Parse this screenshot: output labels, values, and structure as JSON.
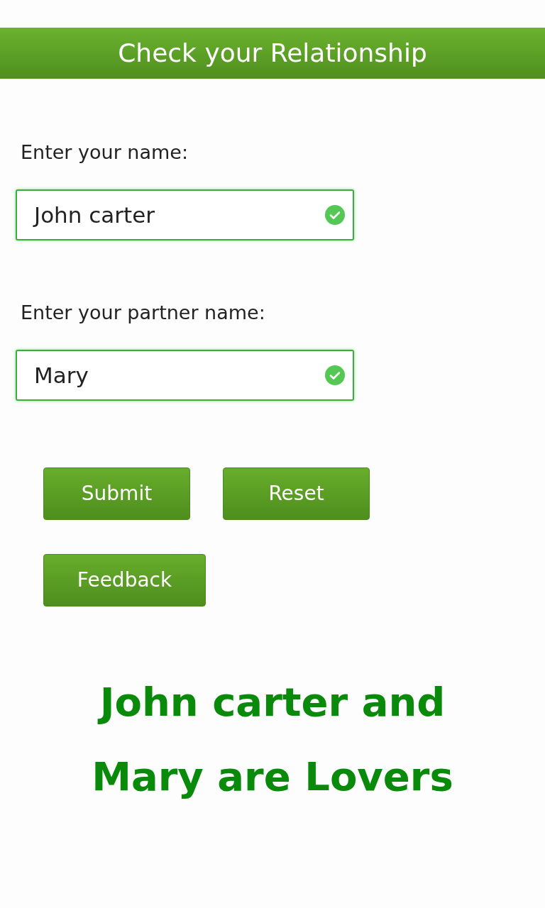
{
  "header": {
    "title": "Check your Relationship"
  },
  "fields": [
    {
      "label": "Enter your name:",
      "value": "John carter",
      "valid": true
    },
    {
      "label": "Enter your partner name:",
      "value": "Mary",
      "valid": true
    }
  ],
  "buttons": [
    {
      "label": "Submit"
    },
    {
      "label": "Reset"
    },
    {
      "label": "Feedback"
    }
  ],
  "result": "John carter and Mary are Lovers"
}
